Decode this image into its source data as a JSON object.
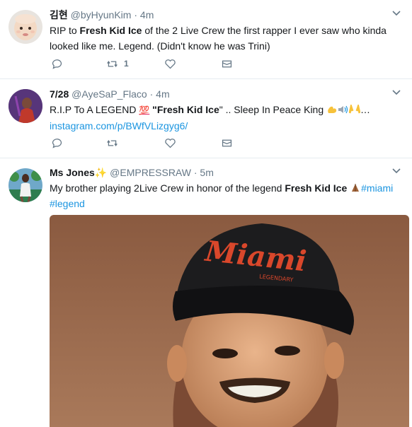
{
  "tweets": [
    {
      "name": "김현",
      "handle": "@byHyunKim",
      "sep": "·",
      "time": "4m",
      "text_before": "RIP to ",
      "bold": "Fresh Kid Ice",
      "text_after": " of the 2 Live Crew the first rapper I ever saw who kinda looked like me. Legend. (Didn't know he was Trini)",
      "retweet_count": "1"
    },
    {
      "name": "7/28",
      "handle": "@AyeSaP_Flaco",
      "sep": "·",
      "time": "4m",
      "text_before": "R.I.P To A LEGEND ",
      "emoji_100": "💯",
      "text_quote_open": " \"",
      "bold": "Fresh Kid Ice",
      "text_after": "\" .. Sleep In Peace King ",
      "ellipsis": "…",
      "link": "instagram.com/p/BWfVLizgyg6/",
      "retweet_count": ""
    },
    {
      "name": "Ms Jones",
      "name_emoji": "✨",
      "handle": "@EMPRESSRAW",
      "sep": "·",
      "time": "5m",
      "text_before": "My brother playing 2Live Crew in honor of the legend ",
      "bold": "Fresh Kid Ice",
      "text_after": " ",
      "hashtag1": "#miami",
      "hashtag2": "#legend",
      "media": {
        "cap_text": "Miami",
        "cap_subtext": "LEGENDARY"
      }
    }
  ],
  "colors": {
    "text": "#14171a",
    "secondary": "#657786",
    "link": "#1b95e0",
    "divider": "#e6ecf0"
  }
}
